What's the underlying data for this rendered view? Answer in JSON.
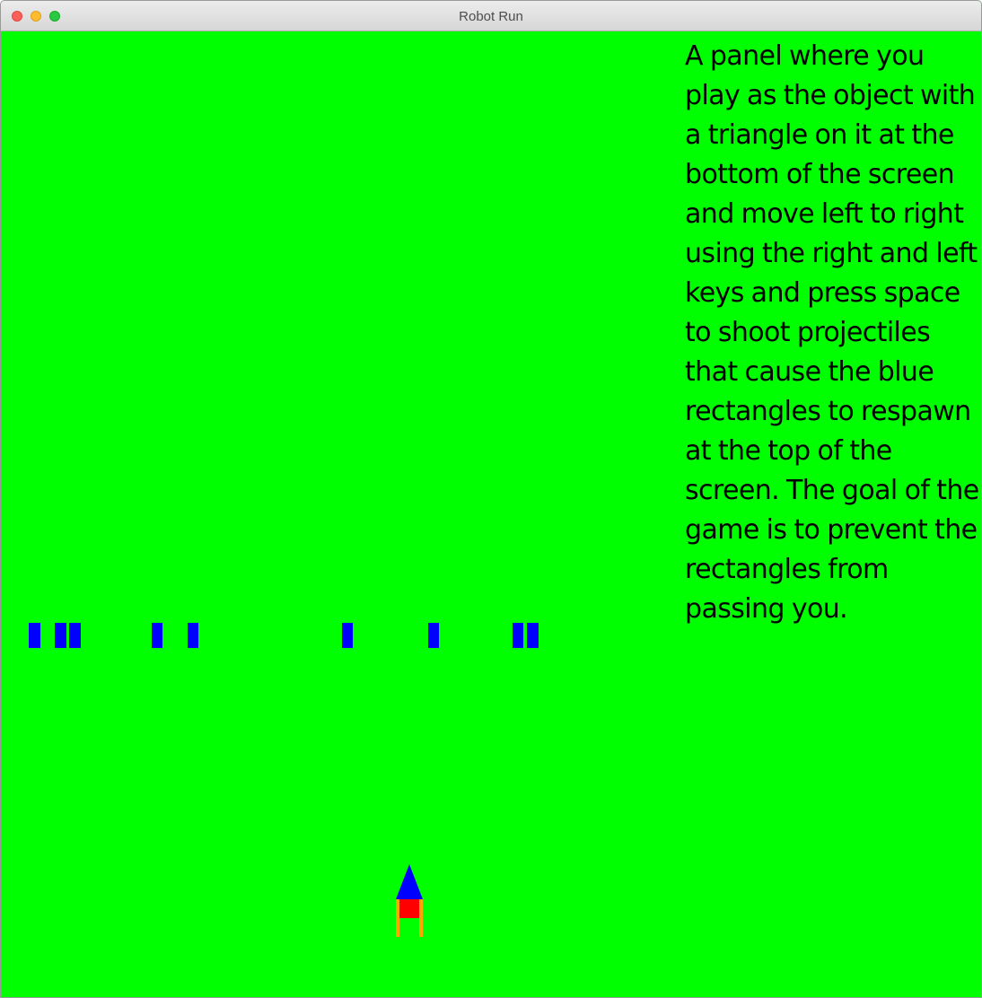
{
  "window": {
    "title": "Robot Run"
  },
  "game": {
    "background_color": "#00ff00",
    "instructions": "A panel where you play as the object with a triangle on it at the bottom of the screen and move left to right using the right and left keys and press space to shoot projectiles that cause the blue rectangles to respawn at the top of the screen. The goal of the game is to prevent the rectangles from passing you.",
    "enemy_count": 10,
    "enemy_color": "#0000ff",
    "player": {
      "triangle_color": "#0000ff",
      "body_color": "#ff0000",
      "legs_color": "#ffa500"
    }
  }
}
